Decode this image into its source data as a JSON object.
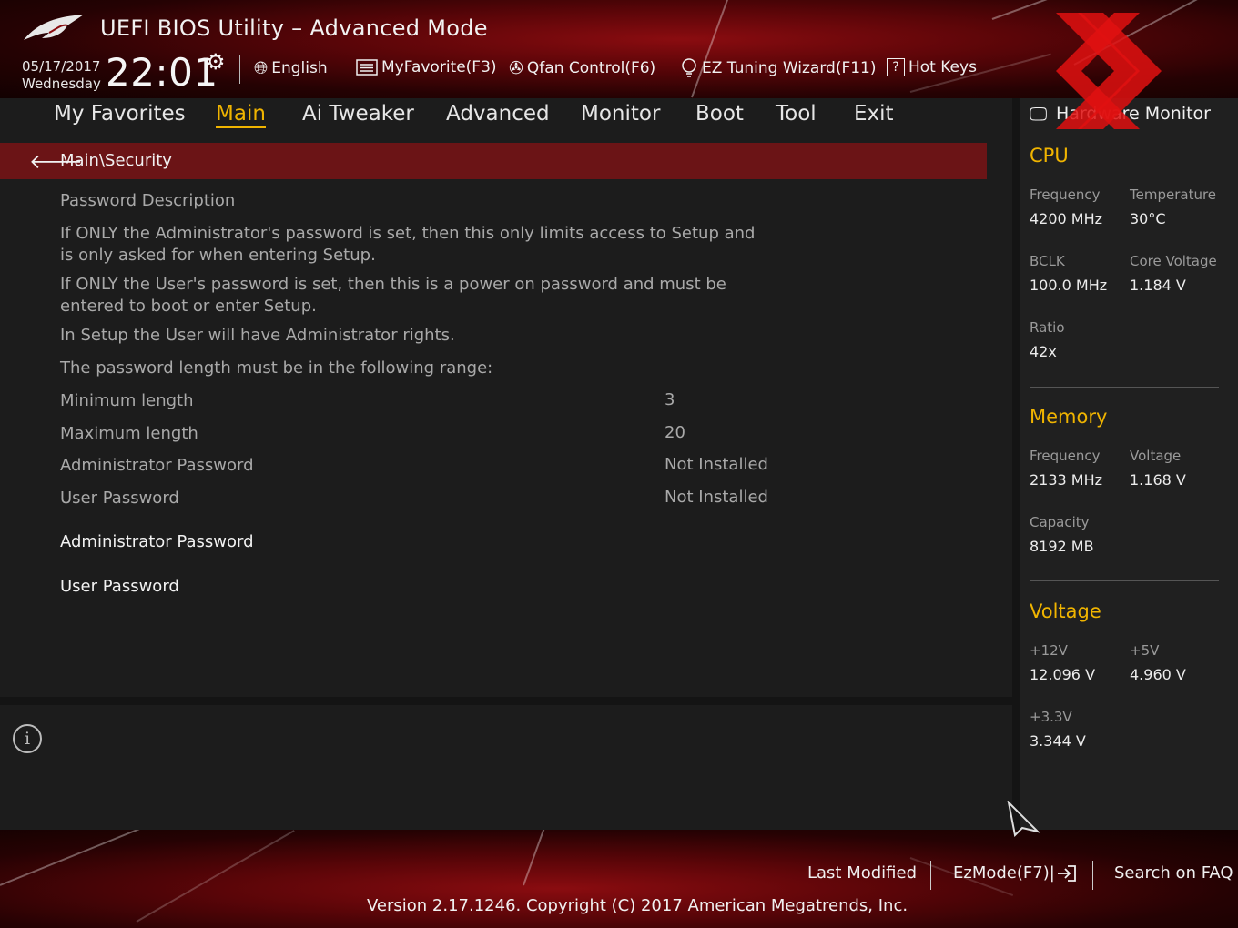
{
  "header": {
    "title": "UEFI BIOS Utility – Advanced Mode",
    "date": "05/17/2017",
    "weekday": "Wednesday",
    "time": "22:01",
    "toolbar": [
      {
        "name": "language",
        "icon": "globe-icon",
        "label": "English"
      },
      {
        "name": "myfavorite",
        "icon": "list-icon",
        "label": "MyFavorite(F3)"
      },
      {
        "name": "qfan",
        "icon": "fan-icon",
        "label": "Qfan Control(F6)"
      },
      {
        "name": "ez-tuning",
        "icon": "lightbulb-icon",
        "label": "EZ Tuning Wizard(F11)"
      },
      {
        "name": "hotkeys",
        "icon": "question-box-icon",
        "label": "Hot Keys"
      }
    ]
  },
  "nav": {
    "tabs": [
      {
        "label": "My Favorites",
        "active": false
      },
      {
        "label": "Main",
        "active": true
      },
      {
        "label": "Ai Tweaker",
        "active": false
      },
      {
        "label": "Advanced",
        "active": false
      },
      {
        "label": "Monitor",
        "active": false
      },
      {
        "label": "Boot",
        "active": false
      },
      {
        "label": "Tool",
        "active": false
      },
      {
        "label": "Exit",
        "active": false
      }
    ],
    "accent_color": "#f0b400"
  },
  "main": {
    "breadcrumb": "Main\\Security",
    "description_title": "Password Description",
    "desc1_line1": "If ONLY the Administrator's password is set, then this only limits access to Setup and",
    "desc1_line2": "is only asked for when entering Setup.",
    "desc2_line1": "If ONLY the User's password is set, then this is a power on password and must be",
    "desc2_line2": "entered to boot or enter Setup.",
    "desc3": "In Setup the User will have Administrator rights.",
    "desc4": "The password length must be in the following range:",
    "rows": [
      {
        "label": "Minimum length",
        "value": "3"
      },
      {
        "label": "Maximum length",
        "value": "20"
      },
      {
        "label": "Administrator Password",
        "value": "Not Installed"
      },
      {
        "label": "User Password",
        "value": "Not Installed"
      }
    ],
    "items": [
      {
        "label": "Administrator Password"
      },
      {
        "label": "User Password"
      }
    ]
  },
  "hw_monitor": {
    "title": "Hardware Monitor",
    "cpu": {
      "title": "CPU",
      "frequency_label": "Frequency",
      "frequency": "4200 MHz",
      "temperature_label": "Temperature",
      "temperature": "30°C",
      "bclk_label": "BCLK",
      "bclk": "100.0 MHz",
      "core_voltage_label": "Core Voltage",
      "core_voltage": "1.184 V",
      "ratio_label": "Ratio",
      "ratio": "42x"
    },
    "memory": {
      "title": "Memory",
      "frequency_label": "Frequency",
      "frequency": "2133 MHz",
      "voltage_label": "Voltage",
      "voltage": "1.168 V",
      "capacity_label": "Capacity",
      "capacity": "8192 MB"
    },
    "voltage": {
      "title": "Voltage",
      "v12_label": "+12V",
      "v12": "12.096 V",
      "v5_label": "+5V",
      "v5": "4.960 V",
      "v33_label": "+3.3V",
      "v33": "3.344 V"
    }
  },
  "footer": {
    "last_modified": "Last Modified",
    "ezmode": "EzMode(F7)|",
    "search_faq": "Search on FAQ",
    "version": "Version 2.17.1246. Copyright (C) 2017 American Megatrends, Inc."
  }
}
